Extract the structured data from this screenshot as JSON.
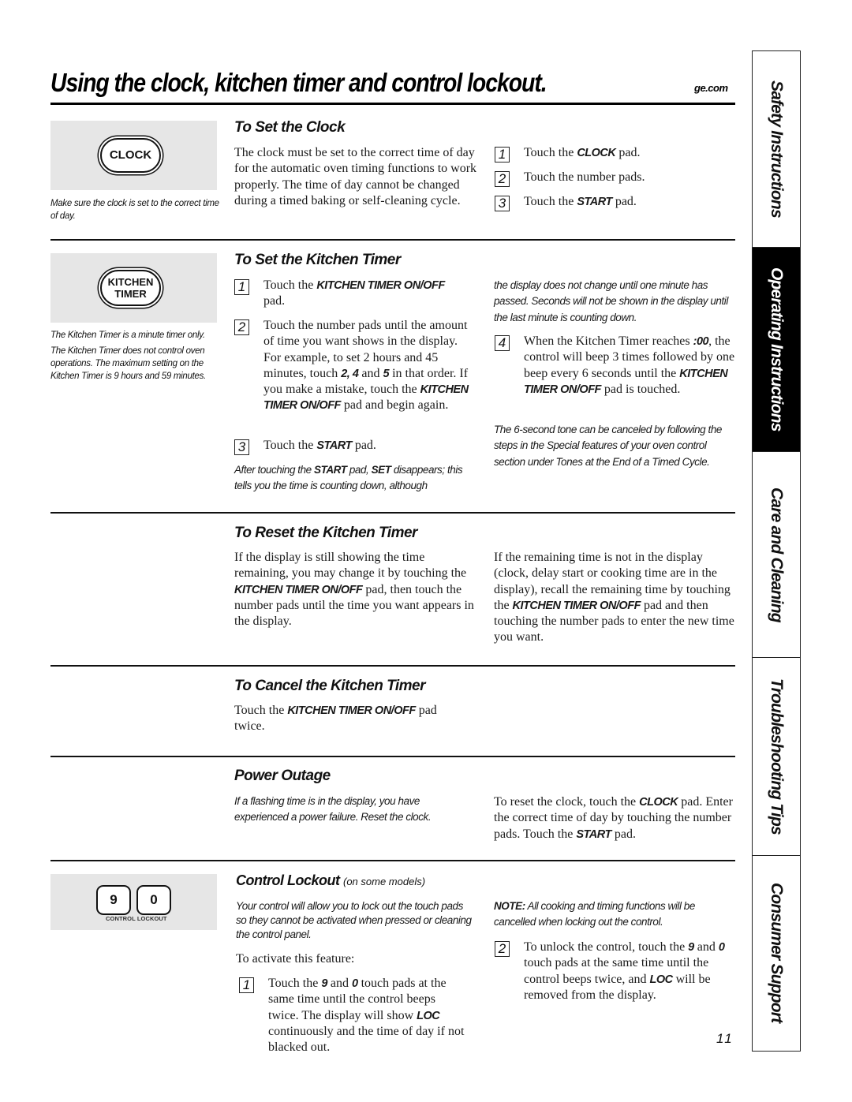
{
  "header": {
    "title": "Using the clock, kitchen timer and control lockout.",
    "site": "ge.com"
  },
  "side_tabs": [
    {
      "label": "Safety Instructions",
      "active": false
    },
    {
      "label": "Operating Instructions",
      "active": true
    },
    {
      "label": "Care and Cleaning",
      "active": false
    },
    {
      "label": "Troubleshooting Tips",
      "active": false
    },
    {
      "label": "Consumer Support",
      "active": false
    }
  ],
  "set_clock": {
    "pad_label": "CLOCK",
    "caption": "Make sure the clock is set to the correct time of day.",
    "heading": "To Set the Clock",
    "body": "The clock must be set to the correct time of day for the automatic oven timing functions to work properly. The time of day cannot be changed during a timed baking or self-cleaning cycle.",
    "steps": [
      {
        "num": "1",
        "pre": "Touch the ",
        "kw": "CLOCK",
        "post": " pad."
      },
      {
        "num": "2",
        "pre": "Touch the number pads.",
        "kw": "",
        "post": ""
      },
      {
        "num": "3",
        "pre": "Touch the ",
        "kw": "START",
        "post": " pad."
      }
    ]
  },
  "set_timer": {
    "pad_label_line1": "KITCHEN",
    "pad_label_line2": "TIMER",
    "caption1": "The Kitchen Timer is a minute timer only.",
    "caption2": "The Kitchen Timer does not control oven operations. The maximum setting on the Kitchen Timer is 9 hours and 59 minutes.",
    "heading": "To Set the Kitchen Timer",
    "step1": {
      "num": "1",
      "pre": "Touch the ",
      "kw": "KITCHEN TIMER ON/OFF",
      "post": " pad."
    },
    "step2": {
      "num": "2",
      "text1": "Touch the number pads until the amount of time you want shows in the display. For example, to set 2 hours and 45 minutes, touch ",
      "kw1": "2, 4",
      "text2": " and ",
      "kw2": "5",
      "text3": " in that order. If you make a mistake, touch the ",
      "kw3": "KITCHEN TIMER ON/OFF",
      "text4": " pad and begin again."
    },
    "step3": {
      "num": "3",
      "pre": "Touch the ",
      "kw": "START",
      "post": " pad."
    },
    "note_a": {
      "t1": "After touching the ",
      "k1": "START",
      "t2": " pad, ",
      "k2": "SET",
      "t3": " disappears; this tells you the time is counting down, although"
    },
    "note_b": "the display does not change until one minute has passed. Seconds will not be shown in the display until the last minute is counting down.",
    "step4": {
      "num": "4",
      "t1": "When the Kitchen Timer reaches ",
      "k1": ":00",
      "t2": ", the control will beep 3 times followed by one beep every 6 seconds until the ",
      "k2": "KITCHEN TIMER ON/OFF",
      "t3": " pad is touched."
    },
    "note_c": "The 6-second tone can be canceled by following the steps in the Special features of your oven control section under Tones at the End of a Timed Cycle."
  },
  "reset_timer": {
    "heading": "To Reset the Kitchen Timer",
    "left": {
      "t1": "If the display is still showing the time remaining, you may change it by touching the ",
      "kw": "KITCHEN TIMER ON/OFF",
      "t2": " pad, then touch the number pads until the time you want appears in the display."
    },
    "right": {
      "t1": "If the remaining time is not in the display (clock, delay start or cooking time are in the display), recall the remaining time by touching the ",
      "kw": "KITCHEN TIMER ON/OFF",
      "t2": " pad and then touching the number pads to enter the new time you want."
    }
  },
  "cancel_timer": {
    "heading": "To Cancel the Kitchen Timer",
    "t1": "Touch the ",
    "kw": "KITCHEN TIMER ON/OFF",
    "t2": " pad twice."
  },
  "power_outage": {
    "heading": "Power Outage",
    "note": "If a flashing time is in the display, you have experienced a power failure. Reset the clock.",
    "right": {
      "t1": "To reset the clock, touch the ",
      "k1": "CLOCK",
      "t2": " pad. Enter the correct time of day by touching the number pads. Touch the ",
      "k2": "START",
      "t3": " pad."
    }
  },
  "control_lockout": {
    "pad_9": "9",
    "pad_0": "0",
    "pad_sublabel": "CONTROL LOCKOUT",
    "heading": "Control Lockout",
    "heading_suffix": "(on some models)",
    "intro": "Your control will allow you to lock out the touch pads so they cannot be activated when pressed or cleaning the control panel.",
    "activate_label": "To activate this feature:",
    "step1": {
      "num": "1",
      "t1": "Touch the ",
      "k1": "9",
      "t2": " and ",
      "k2": "0",
      "t3": " touch pads at the same time until the control beeps twice. The display will show ",
      "k3": "LOC",
      "t4": " continuously and the time of day if not blacked out."
    },
    "note_label": "NOTE:",
    "note_text": " All cooking and timing functions will be cancelled when locking out the control.",
    "step2": {
      "num": "2",
      "t1": "To unlock the control, touch the ",
      "k1": "9",
      "t2": " and ",
      "k2": "0",
      "t3": " touch pads at the same time until the control beeps twice, and ",
      "k3": "LOC",
      "t4": " will be removed from the display."
    }
  },
  "footer": {
    "page_number": "11"
  }
}
